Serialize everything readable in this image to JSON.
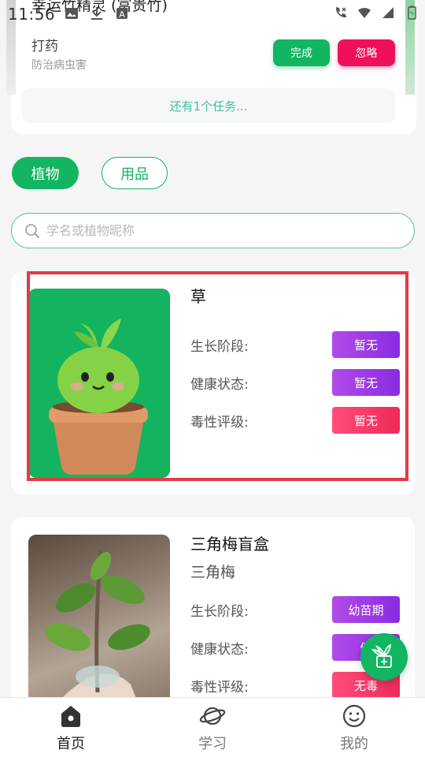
{
  "status_bar": {
    "time": "11:56"
  },
  "task_card": {
    "app_title": "幸运竹精灵 (富贵竹)",
    "task_name": "打药",
    "task_sub": "防治病虫害",
    "done_label": "完成",
    "ignore_label": "忽略",
    "more_tasks": "还有1个任务..."
  },
  "tabs": {
    "plants": "植物",
    "supplies": "用品"
  },
  "search": {
    "placeholder": "学名或植物昵称"
  },
  "plants": [
    {
      "name": "草",
      "alias": "",
      "growth_label": "生长阶段:",
      "growth_value": "暂无",
      "health_label": "健康状态:",
      "health_value": "暂无",
      "toxicity_label": "毒性评级:",
      "toxicity_value": "暂无"
    },
    {
      "name": "三角梅盲盒",
      "alias": "三角梅",
      "growth_label": "生长阶段:",
      "growth_value": "幼苗期",
      "health_label": "健康状态:",
      "health_value": "健",
      "toxicity_label": "毒性评级:",
      "toxicity_value": "无毒"
    }
  ],
  "bottom_nav": {
    "home": "首页",
    "learn": "学习",
    "mine": "我的"
  },
  "colors": {
    "brand_green": "#12b561",
    "danger_pink": "#f0105a",
    "badge_purple": "#9b3ae6",
    "highlight_red": "#e53945"
  }
}
